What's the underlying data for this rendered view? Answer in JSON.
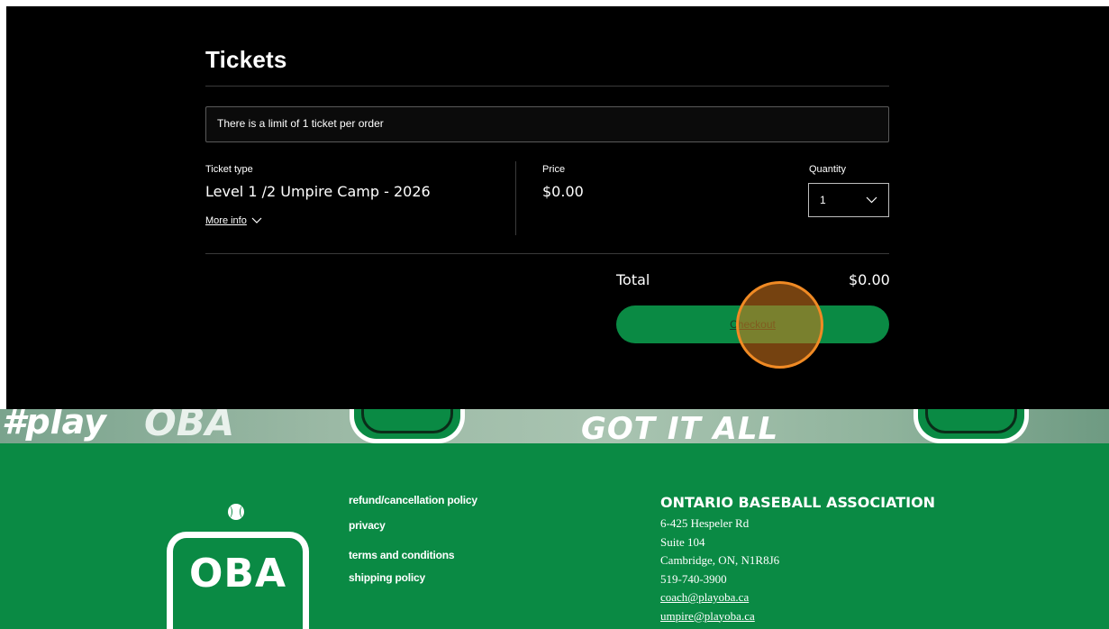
{
  "tickets": {
    "title": "Tickets",
    "notice": "There is a limit of 1 ticket per order",
    "ticket_type_label": "Ticket type",
    "ticket_name": "Level 1 /2 Umpire Camp - 2026",
    "more_info": "More info",
    "price_label": "Price",
    "price_value": "$0.00",
    "quantity_label": "Quantity",
    "quantity_value": "1",
    "total_label": "Total",
    "total_value": "$0.00",
    "checkout_label": "Checkout"
  },
  "banner": {
    "hashtag": "#play",
    "brand": "OBA",
    "slogan": "GOT IT ALL"
  },
  "footer": {
    "logo_text": "OBA",
    "links": [
      "refund/cancellation policy",
      "privacy",
      "terms and conditions",
      "shipping policy"
    ],
    "org_name": "ONTARIO BASEBALL ASSOCIATION",
    "address_lines": [
      "6-425 Hespeler Rd",
      "Suite 104",
      "Cambridge, ON, N1R8J6",
      "519-740-3900"
    ],
    "emails": [
      "coach@playoba.ca",
      "umpire@playoba.ca"
    ]
  },
  "colors": {
    "panel_bg": "#000000",
    "accent_green": "#0a8a44",
    "click_marker": "#f08a24"
  }
}
